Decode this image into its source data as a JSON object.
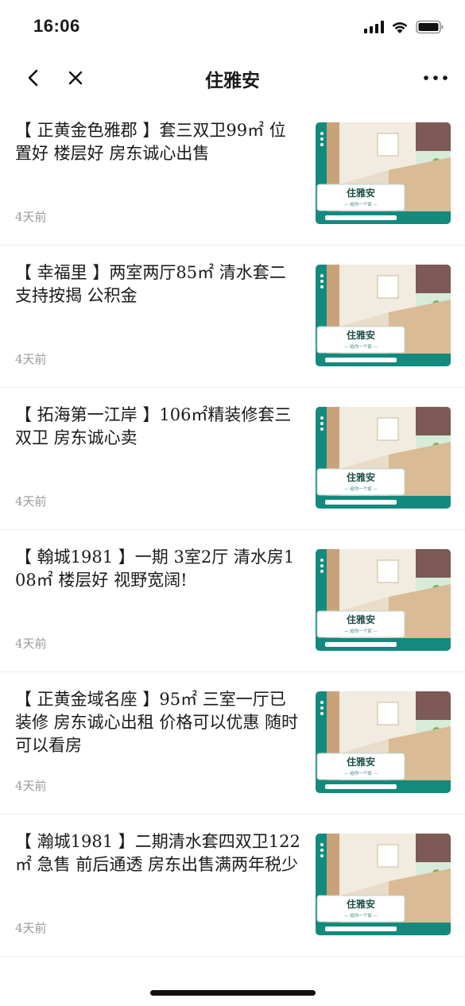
{
  "status_bar": {
    "time": "16:06"
  },
  "nav": {
    "title": "住雅安"
  },
  "thumbnail": {
    "brand": "住雅安",
    "tagline": "— 给你一个家 —",
    "colors": {
      "teal": "#148a7e",
      "wood": "#d9bb95",
      "wall": "#f2ebe0"
    }
  },
  "posts": [
    {
      "title": "【 正黄金色雅郡 】套三双卫99㎡ 位置好  楼层好  房东诚心出售",
      "time": "4天前"
    },
    {
      "title": "【 幸福里 】两室两厅85㎡  清水套二  支持按揭  公积金",
      "time": "4天前"
    },
    {
      "title": "【 拓海第一江岸 】106㎡精装修套三双卫  房东诚心卖",
      "time": "4天前"
    },
    {
      "title": "【 翰城1981 】一期  3室2厅  清水房108㎡  楼层好  视野宽阔!",
      "time": "4天前"
    },
    {
      "title": "【 正黄金域名座 】95㎡  三室一厅已装修  房东诚心出租  价格可以优惠  随时可以看房",
      "time": "4天前"
    },
    {
      "title": "【 瀚城1981 】二期清水套四双卫122㎡  急售  前后通透  房东出售满两年税少",
      "time": "4天前"
    }
  ]
}
